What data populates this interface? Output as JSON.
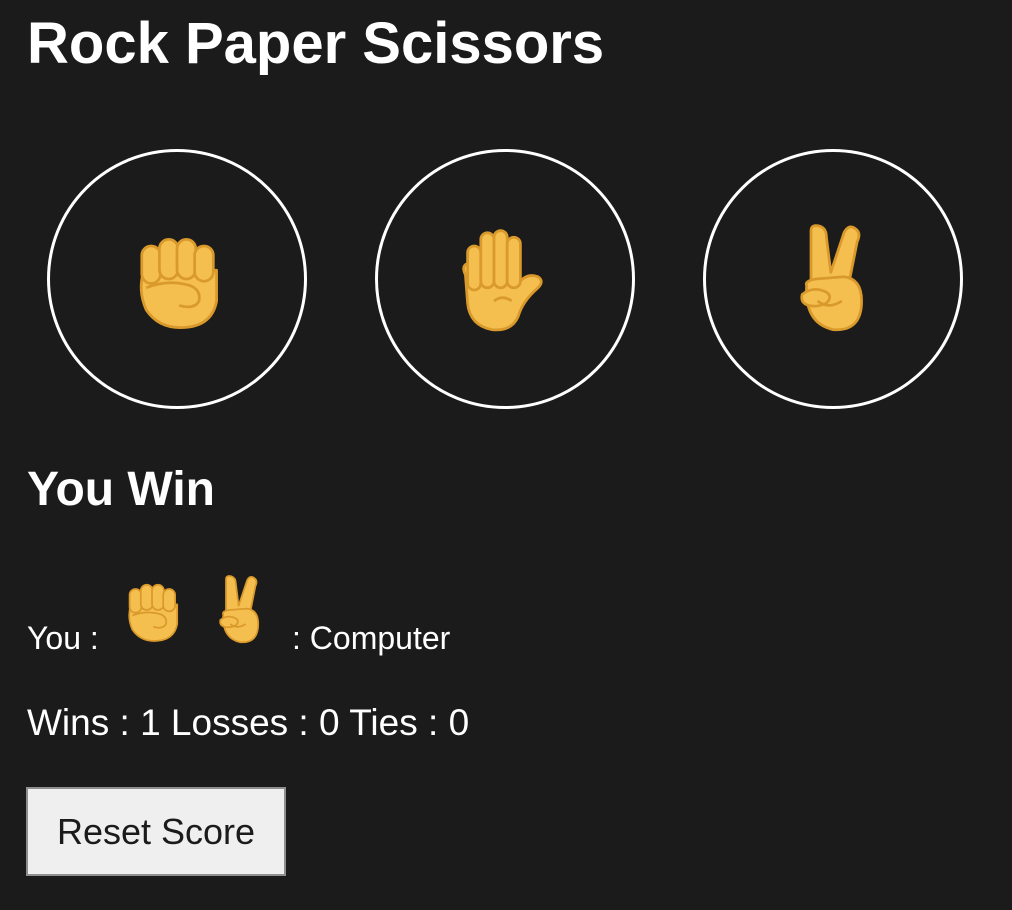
{
  "page_title": "Rock Paper Scissors",
  "choices": [
    {
      "id": "rock",
      "icon": "raised-fist-icon"
    },
    {
      "id": "paper",
      "icon": "raised-hand-icon"
    },
    {
      "id": "scissors",
      "icon": "victory-hand-icon"
    }
  ],
  "result_text": "You Win",
  "matchup": {
    "player_label": "You :",
    "computer_label": ": Computer",
    "player_choice": "rock",
    "computer_choice": "scissors"
  },
  "score": {
    "wins_label": "Wins :",
    "wins": "1",
    "losses_label": "Losses :",
    "losses": "0",
    "ties_label": "Ties :",
    "ties": "0"
  },
  "reset_button_label": "Reset Score",
  "colors": {
    "background": "#1b1b1b",
    "text": "#ffffff",
    "circle_border": "#ffffff",
    "skin": "#f5bf4f",
    "skin_line": "#d99a2b",
    "button_bg": "#efefef"
  }
}
